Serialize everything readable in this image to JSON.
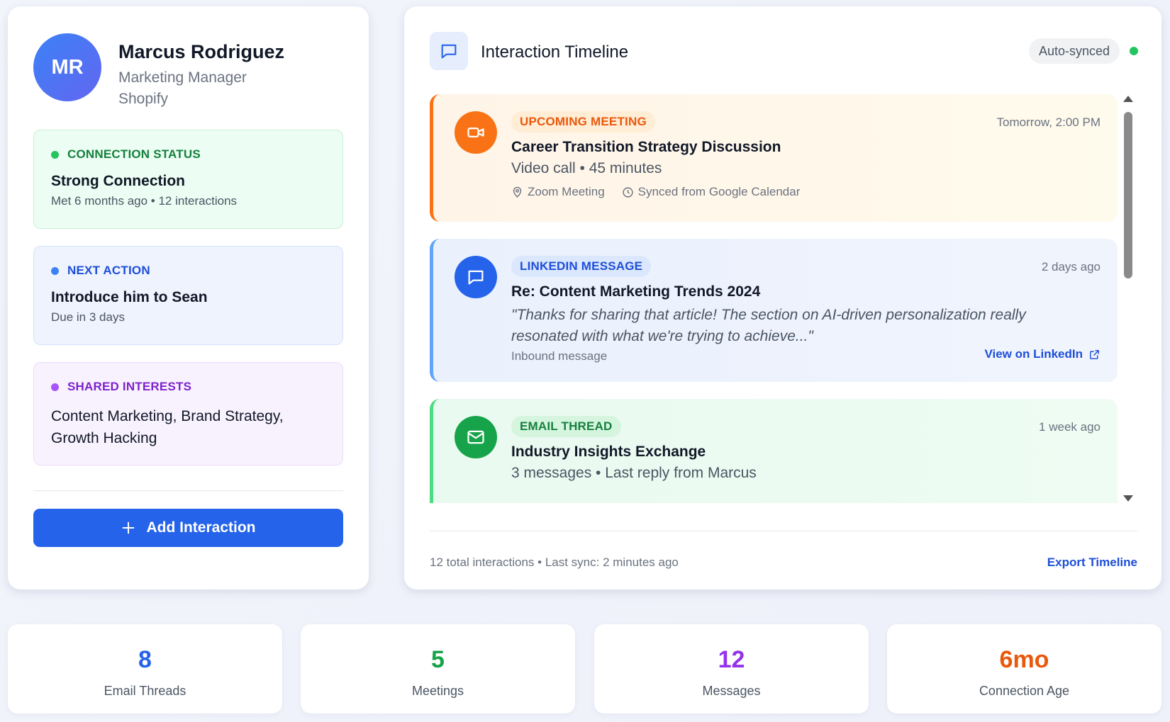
{
  "profile": {
    "initials": "MR",
    "name": "Marcus Rodriguez",
    "role": "Marketing Manager",
    "company": "Shopify"
  },
  "connection_status": {
    "heading": "CONNECTION STATUS",
    "title": "Strong Connection",
    "subtitle": "Met 6 months ago • 12 interactions"
  },
  "next_action": {
    "heading": "NEXT ACTION",
    "title": "Introduce him to Sean",
    "subtitle": "Due in 3 days"
  },
  "shared_interests": {
    "heading": "SHARED INTERESTS",
    "text": "Content Marketing, Brand Strategy, Growth Hacking"
  },
  "add_button": {
    "label": "Add Interaction",
    "icon": "plus-icon"
  },
  "timeline": {
    "title": "Interaction Timeline",
    "icon": "chat-bubble-icon",
    "sync_badge": "Auto-synced",
    "items": [
      {
        "type": "meeting",
        "icon": "video-camera-icon",
        "badge": "UPCOMING MEETING",
        "time": "Tomorrow, 2:00 PM",
        "title": "Career Transition Strategy Discussion",
        "subtitle": "Video call • 45 minutes",
        "location": "Zoom Meeting",
        "source": "Synced from Google Calendar"
      },
      {
        "type": "linkedin",
        "icon": "chat-bubble-icon",
        "badge": "LINKEDIN MESSAGE",
        "time": "2 days ago",
        "title": "Re: Content Marketing Trends 2024",
        "quote": "\"Thanks for sharing that article! The section on AI-driven personalization really resonated with what we're trying to achieve...\"",
        "direction": "Inbound message",
        "link_label": "View on LinkedIn"
      },
      {
        "type": "email",
        "icon": "envelope-icon",
        "badge": "EMAIL THREAD",
        "time": "1 week ago",
        "title": "Industry Insights Exchange",
        "subtitle": "3 messages • Last reply from Marcus"
      }
    ],
    "footer": "12 total interactions • Last sync: 2 minutes ago",
    "export_label": "Export Timeline"
  },
  "stats": [
    {
      "value": "8",
      "label": "Email Threads",
      "color": "#2563eb"
    },
    {
      "value": "5",
      "label": "Meetings",
      "color": "#16a34a"
    },
    {
      "value": "12",
      "label": "Messages",
      "color": "#9333ea"
    },
    {
      "value": "6mo",
      "label": "Connection Age",
      "color": "#ea580c"
    }
  ],
  "colors": {
    "primary": "#2563eb",
    "meeting_accent": "#f97316",
    "linkedin_accent": "#2563eb",
    "email_accent": "#16a34a",
    "status_green": "#22c55e"
  }
}
